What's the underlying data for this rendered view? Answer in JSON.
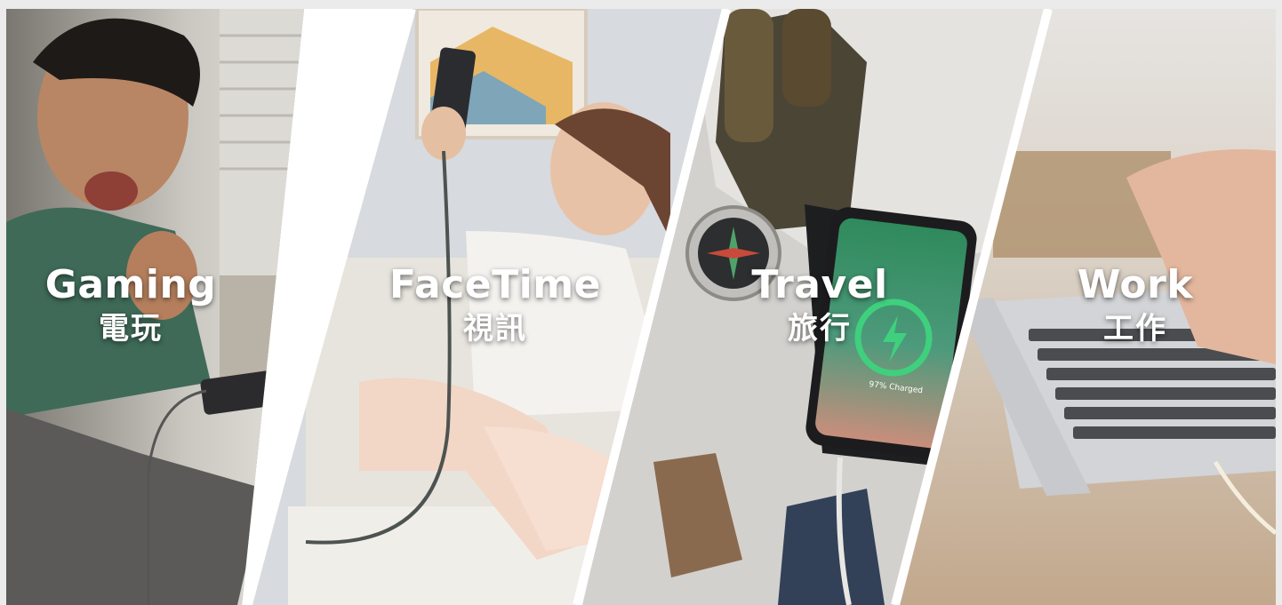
{
  "panels": [
    {
      "en": "Gaming",
      "zh": "電玩"
    },
    {
      "en": "FaceTime",
      "zh": "視訊"
    },
    {
      "en": "Travel",
      "zh": "旅行"
    },
    {
      "en": "Work",
      "zh": "工作"
    }
  ],
  "phone_screen": {
    "status_text": "97% Charged"
  },
  "colors": {
    "label": "#ffffff",
    "divider": "#ffffff",
    "phone_green": "#2f8a5c"
  }
}
